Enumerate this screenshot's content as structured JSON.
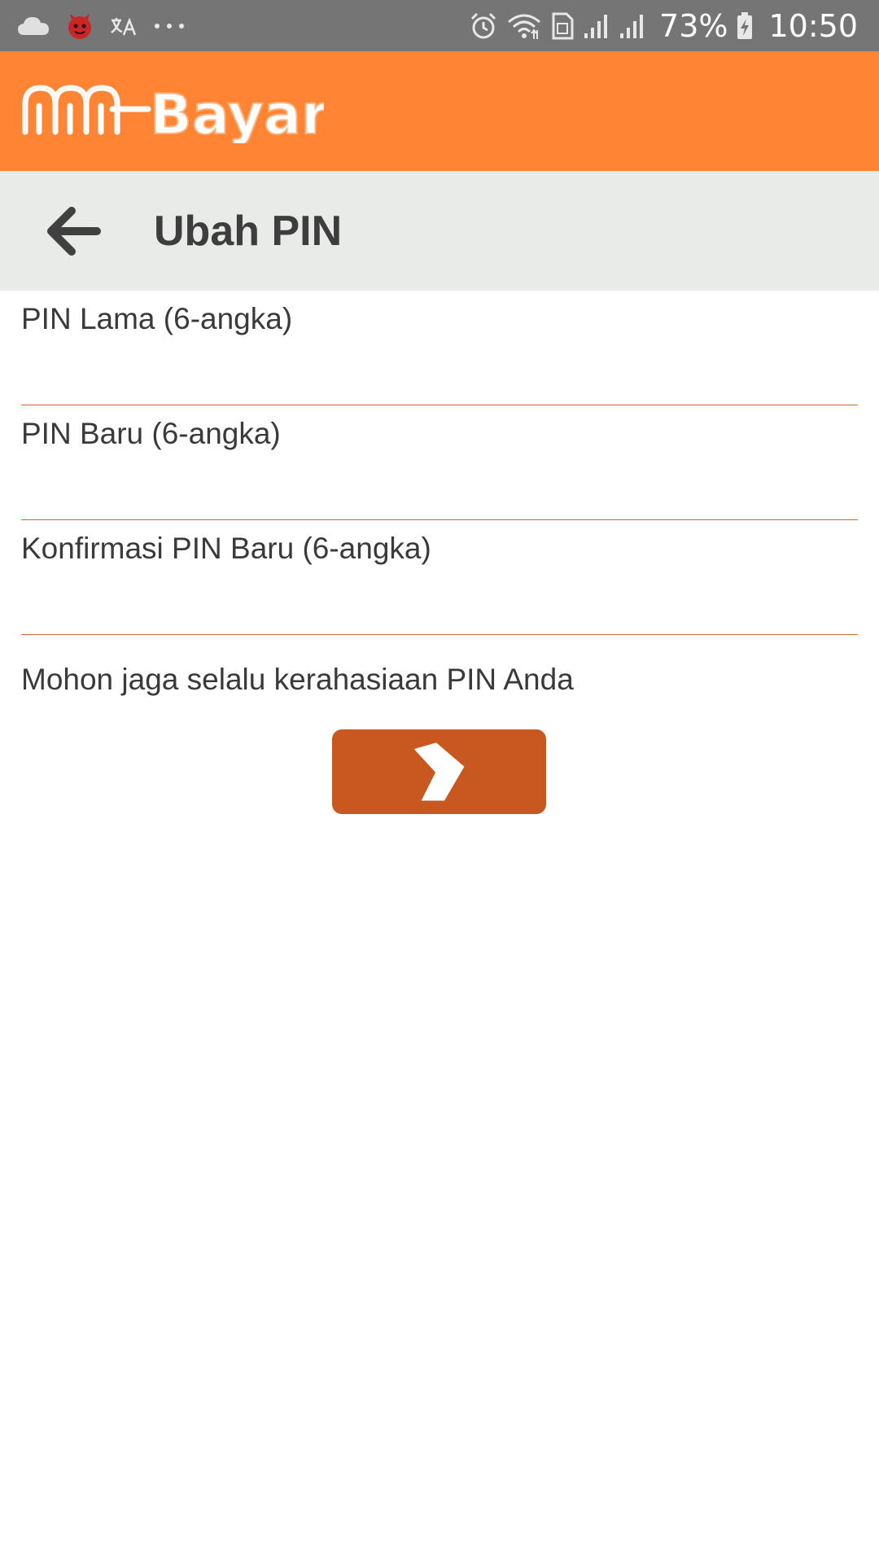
{
  "status_bar": {
    "icons_left": [
      "cloud-icon",
      "antutu-icon",
      "translate-icon",
      "more-dots-icon"
    ],
    "icons_right": [
      "alarm-icon",
      "wifi-icon",
      "sim-icon",
      "signal-icon",
      "signal-icon",
      "battery-charging-icon"
    ],
    "battery_percent": "73%",
    "time": "10:50"
  },
  "header": {
    "logo_text": "mBayar",
    "background_color": "#ff8534"
  },
  "title_bar": {
    "title": "Ubah PIN",
    "back_icon": "arrow-left-icon"
  },
  "form": {
    "old_pin": {
      "placeholder": "PIN Lama (6-angka)",
      "value": ""
    },
    "new_pin": {
      "placeholder": "PIN Baru (6-angka)",
      "value": ""
    },
    "confirm_pin": {
      "placeholder": "Konfirmasi PIN Baru (6-angka)",
      "value": ""
    },
    "note": "Mohon jaga selalu kerahasiaan PIN Anda",
    "submit_icon": "chevron-right-icon",
    "accent_color": "#c8581f"
  }
}
